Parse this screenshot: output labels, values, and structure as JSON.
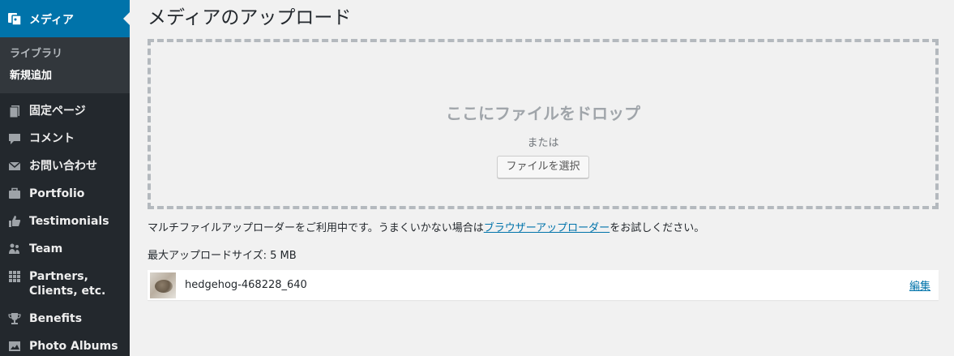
{
  "sidebar": {
    "current": {
      "label": "メディア",
      "icon": "media-icon"
    },
    "submenu": [
      {
        "label": "ライブラリ"
      },
      {
        "label": "新規追加"
      }
    ],
    "items": [
      {
        "label": "固定ページ",
        "icon": "page-icon"
      },
      {
        "label": "コメント",
        "icon": "comment-icon"
      },
      {
        "label": "お問い合わせ",
        "icon": "mail-icon"
      },
      {
        "label": "Portfolio",
        "icon": "briefcase-icon"
      },
      {
        "label": "Testimonials",
        "icon": "thumbs-up-icon"
      },
      {
        "label": "Team",
        "icon": "team-icon"
      },
      {
        "label": "Partners, Clients, etc.",
        "icon": "grid-icon"
      },
      {
        "label": "Benefits",
        "icon": "trophy-icon"
      },
      {
        "label": "Photo Albums",
        "icon": "photo-album-icon"
      }
    ]
  },
  "main": {
    "title": "メディアのアップロード",
    "dropzone": {
      "title": "ここにファイルをドロップ",
      "or": "または",
      "button": "ファイルを選択"
    },
    "note_before": "マルチファイルアップローダーをご利用中です。うまくいかない場合は",
    "note_link": "ブラウザーアップローダー",
    "note_after": "をお試しください。",
    "max_size": "最大アップロードサイズ: 5 MB",
    "media_item": {
      "filename": "hedgehog-468228_640",
      "edit": "編集"
    }
  },
  "colors": {
    "sidebar_bg": "#23282d",
    "accent": "#0073aa",
    "page_bg": "#f1f1f1"
  }
}
